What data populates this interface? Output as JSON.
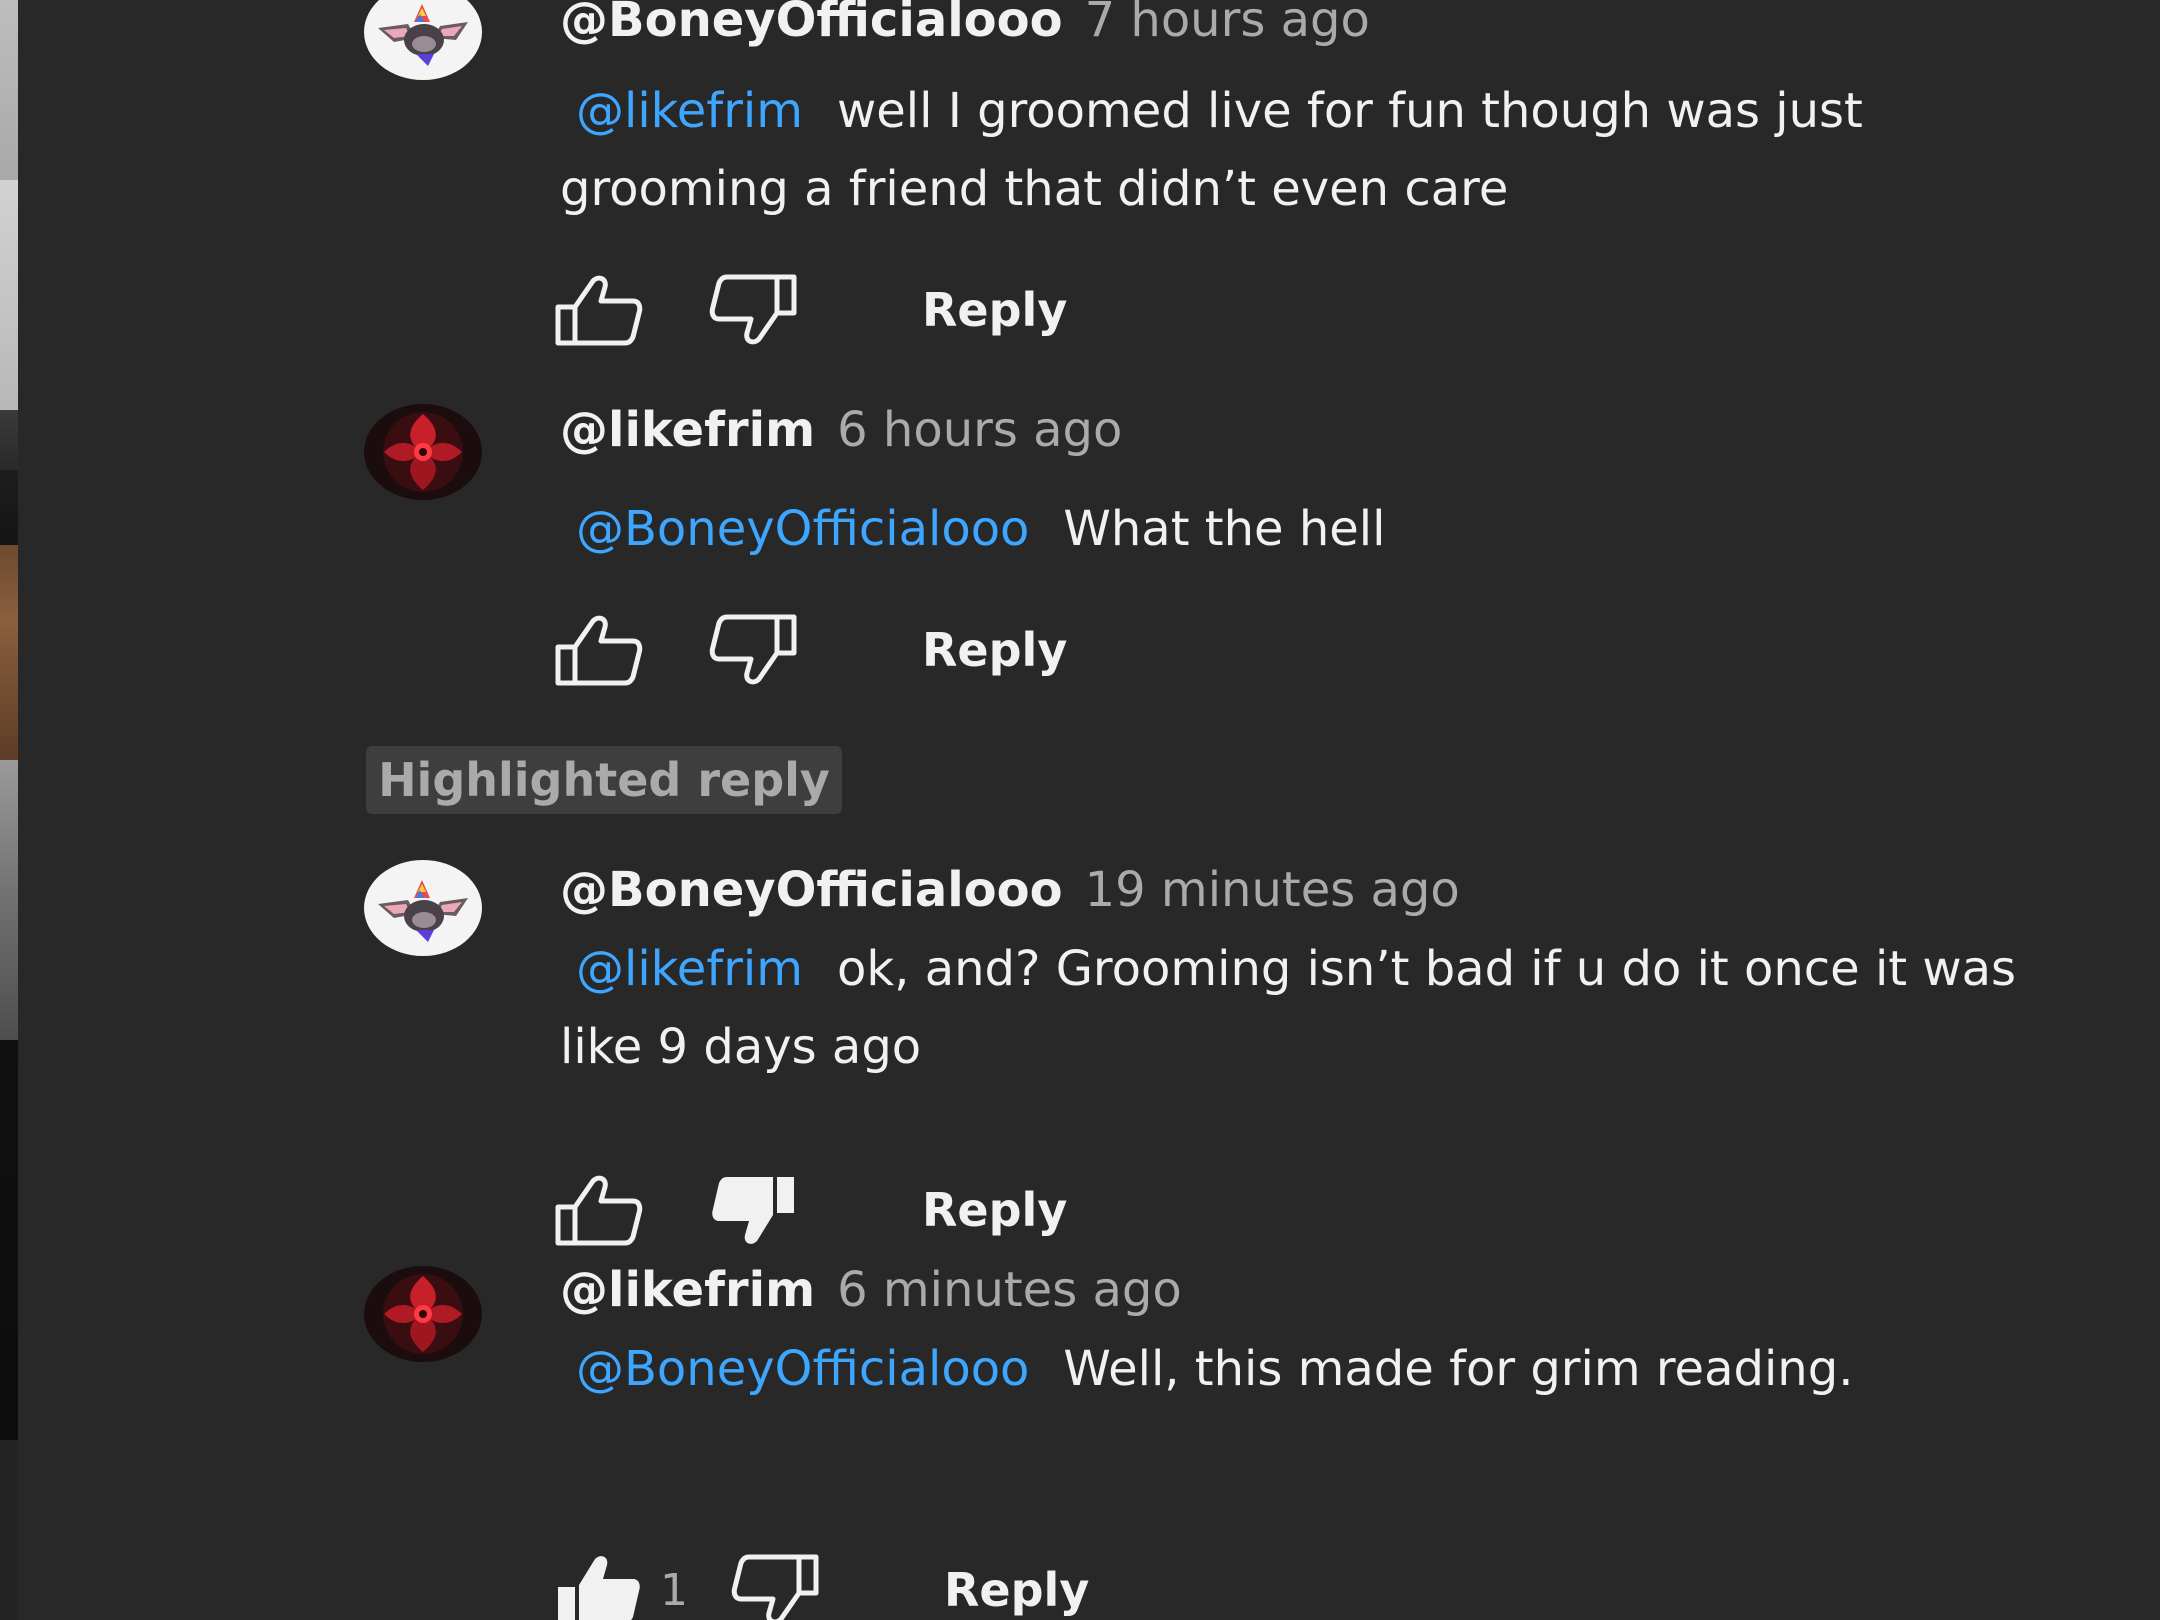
{
  "colors": {
    "background": "#282828",
    "text": "#f1f1f1",
    "secondary_text": "#aaaaaa",
    "mention": "#3ea6ff",
    "badge_bg": "#3e3e3e"
  },
  "thread": {
    "highlighted_label": "Highlighted reply",
    "comments": [
      {
        "author": "@BoneyOfficialooo",
        "avatar_icon": "bat-avatar-icon",
        "timestamp": "7 hours ago",
        "mention": "@likefrim",
        "text": "well I groomed live for fun though was just grooming a friend that didn’t even care",
        "reply_label": "Reply",
        "like_count": "",
        "disliked": false,
        "liked": false
      },
      {
        "author": "@likefrim",
        "avatar_icon": "red-sigil-avatar-icon",
        "timestamp": "6 hours ago",
        "mention": "@BoneyOfficialooo",
        "text": "What the hell",
        "reply_label": "Reply",
        "like_count": "",
        "disliked": false,
        "liked": false
      },
      {
        "author": "@BoneyOfficialooo",
        "avatar_icon": "bat-avatar-icon",
        "timestamp": "19 minutes ago",
        "mention": "@likefrim",
        "text": "ok, and? Grooming isn’t bad if u do it once it was like 9 days ago",
        "reply_label": "Reply",
        "like_count": "",
        "disliked": true,
        "liked": false
      },
      {
        "author": "@likefrim",
        "avatar_icon": "red-sigil-avatar-icon",
        "timestamp": "6 minutes ago",
        "mention": "@BoneyOfficialooo",
        "text": "Well, this made for grim reading.",
        "reply_label": "Reply",
        "like_count": "1",
        "disliked": false,
        "liked": true
      }
    ]
  }
}
